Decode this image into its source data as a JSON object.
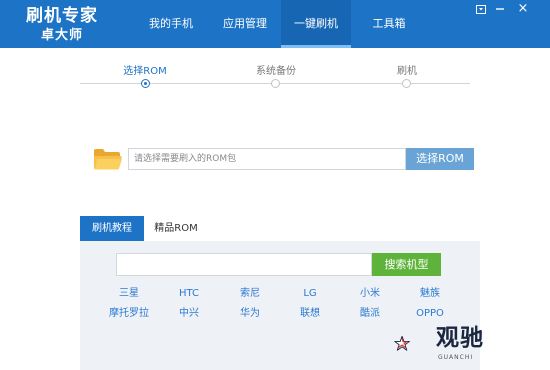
{
  "header": {
    "logo_main": "刷机专家",
    "logo_sub": "卓大师",
    "nav": [
      {
        "label": "我的手机"
      },
      {
        "label": "应用管理"
      },
      {
        "label": "一键刷机"
      },
      {
        "label": "工具箱"
      }
    ],
    "close_glyph": "×",
    "colors": {
      "bar": "#1d73c6",
      "active_tab": "#1666b4"
    }
  },
  "steps": [
    {
      "label": "选择ROM",
      "active": true
    },
    {
      "label": "系统备份",
      "active": false
    },
    {
      "label": "刷机",
      "active": false
    }
  ],
  "rom": {
    "placeholder": "请选择需要刷入的ROM包",
    "value": "",
    "button_label": "选择ROM",
    "icon": "folder-icon"
  },
  "tabs": [
    {
      "label": "刷机教程",
      "active": true
    },
    {
      "label": "精品ROM",
      "active": false
    }
  ],
  "search": {
    "value": "",
    "button_label": "搜索机型"
  },
  "brands": [
    [
      "三星",
      "HTC",
      "索尼",
      "LG",
      "小米",
      "魅族"
    ],
    [
      "摩托罗拉",
      "中兴",
      "华为",
      "联想",
      "酷派",
      "OPPO"
    ]
  ],
  "watermark": {
    "text": "观驰",
    "sub": "GUANCHI"
  }
}
